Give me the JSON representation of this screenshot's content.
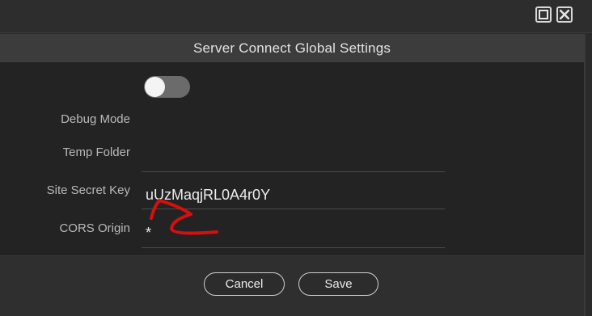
{
  "dialog": {
    "title": "Server Connect Global Settings"
  },
  "fields": {
    "debug_mode": {
      "label": "Debug Mode",
      "enabled": false
    },
    "temp_folder": {
      "label": "Temp Folder",
      "value": ""
    },
    "site_secret_key": {
      "label": "Site Secret Key",
      "value": "uUzMaqjRL0A4r0Y"
    },
    "cors_origin": {
      "label": "CORS Origin",
      "value": "*"
    }
  },
  "footer": {
    "cancel_label": "Cancel",
    "save_label": "Save"
  },
  "window_controls": {
    "maximize_icon": "maximize-icon",
    "close_icon": "close-icon"
  },
  "colors": {
    "dialog_background": "#232323",
    "header_background": "#3c3c3c",
    "annotation_red": "#d60f0f"
  }
}
